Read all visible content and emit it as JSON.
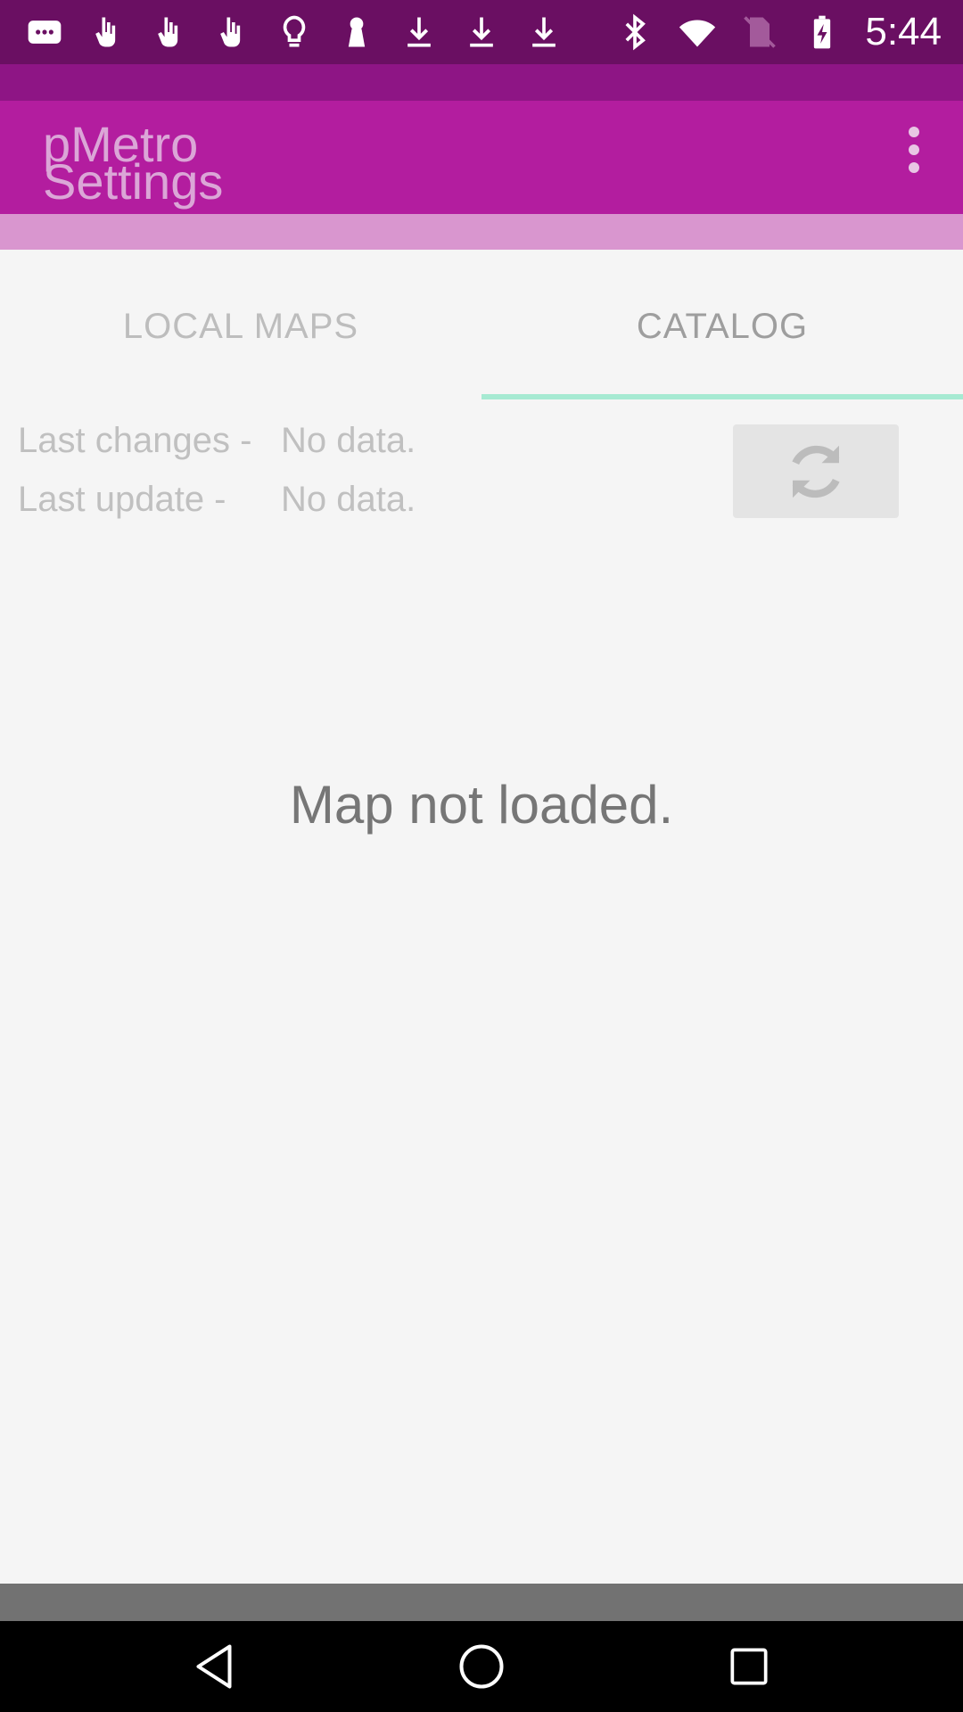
{
  "status_bar": {
    "time": "5:44",
    "left_icons": [
      "chat-bubble-icon",
      "touch-icon",
      "touch-icon",
      "touch-icon",
      "lightbulb-icon",
      "keyhole-icon",
      "download-icon",
      "download-icon",
      "download-icon"
    ],
    "right_icons": [
      "bluetooth-icon",
      "wifi-icon",
      "no-sim-icon",
      "battery-charging-icon"
    ]
  },
  "toolbar": {
    "app_title": "pMetro",
    "subtitle": "Settings",
    "overflow_icon": "more-vert-icon"
  },
  "tabs": [
    {
      "label": "LOCAL MAPS",
      "selected": false
    },
    {
      "label": "CATALOG",
      "selected": true
    }
  ],
  "catalog": {
    "last_changes_label": "Last changes -",
    "last_changes_value": "No data.",
    "last_update_label": "Last update -",
    "last_update_value": "No data.",
    "refresh_icon": "refresh-icon",
    "empty_message": "Map not loaded."
  },
  "colors": {
    "status_bar": "#6a0f62",
    "toolbar": "#b31d9f",
    "tab_indicator": "#a6ead2"
  }
}
